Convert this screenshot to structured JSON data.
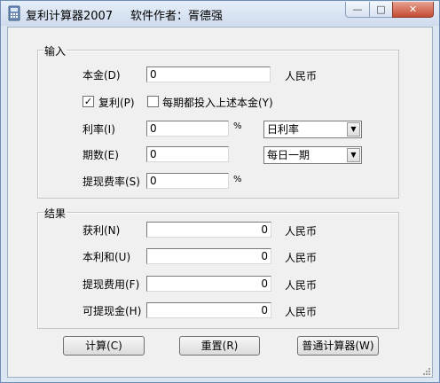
{
  "window": {
    "title": "复利计算器2007",
    "author": "软件作者：胥德强",
    "min_glyph": "—",
    "max_glyph": "□",
    "close_glyph": "✕"
  },
  "input_group": {
    "title": "输入",
    "principal_label": "本金(D)",
    "principal_value": "0",
    "principal_unit": "人民币",
    "compound_label": "复利(P)",
    "compound_checked": true,
    "compound_mark": "✓",
    "reinvest_label": "每期都投入上述本金(Y)",
    "reinvest_checked": false,
    "rate_label": "利率(I)",
    "rate_value": "0",
    "rate_unit": "%",
    "rate_type": "日利率",
    "periods_label": "期数(E)",
    "periods_value": "0",
    "period_type": "每日一期",
    "fee_label": "提现费率(S)",
    "fee_value": "0",
    "fee_unit": "%",
    "dropdown_arrow": "▼"
  },
  "result_group": {
    "title": "结果",
    "profit_label": "获利(N)",
    "profit_value": "0",
    "total_label": "本利和(U)",
    "total_value": "0",
    "fee_cost_label": "提现费用(F)",
    "fee_cost_value": "0",
    "withdrawable_label": "可提现金(H)",
    "withdrawable_value": "0",
    "unit": "人民币"
  },
  "buttons": {
    "calculate": "计算(C)",
    "reset": "重置(R)",
    "basic_calculator": "普通计算器(W)"
  }
}
